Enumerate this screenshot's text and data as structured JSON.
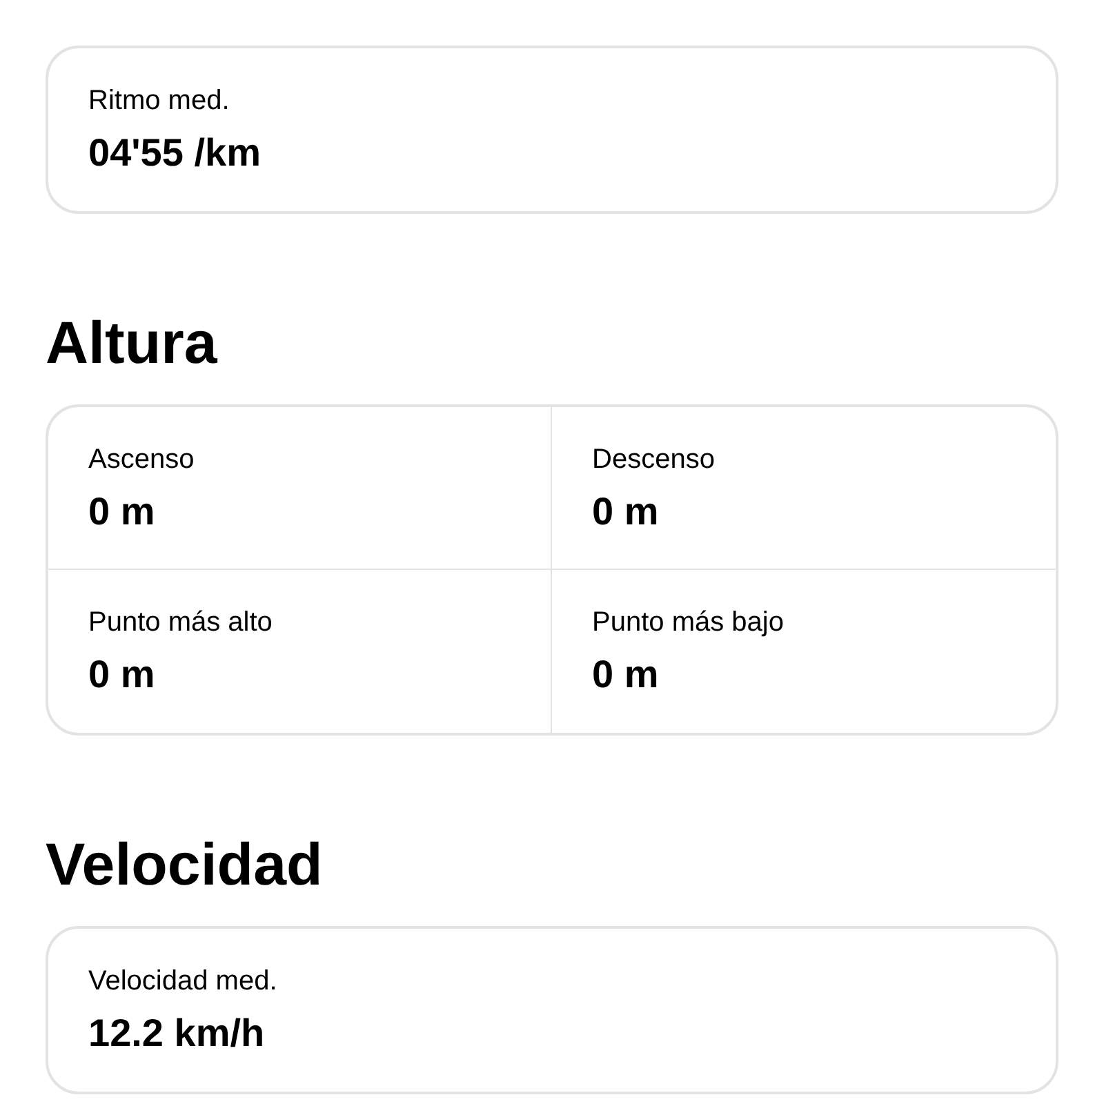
{
  "sections": [
    {
      "metrics": [
        {
          "label": "Ritmo med.",
          "value": "04'55 /km"
        }
      ]
    },
    {
      "title": "Altura",
      "metrics": [
        {
          "label": "Ascenso",
          "value": "0 m"
        },
        {
          "label": "Descenso",
          "value": "0 m"
        },
        {
          "label": "Punto más alto",
          "value": "0 m"
        },
        {
          "label": "Punto más bajo",
          "value": "0 m"
        }
      ]
    },
    {
      "title": "Velocidad",
      "metrics": [
        {
          "label": "Velocidad med.",
          "value": "12.2 km/h"
        }
      ]
    }
  ]
}
